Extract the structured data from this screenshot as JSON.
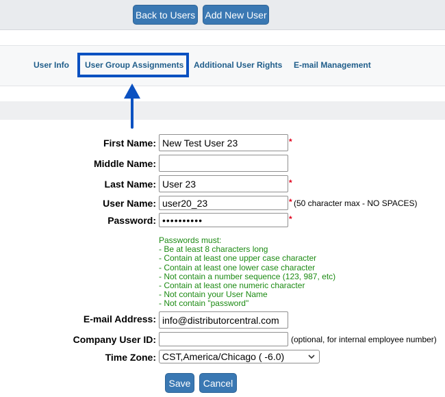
{
  "toolbar": {
    "back_label": "Back to Users",
    "add_label": "Add New User"
  },
  "tabs": [
    {
      "label": "User Info"
    },
    {
      "label": "User Group Assignments"
    },
    {
      "label": "Additional User Rights"
    },
    {
      "label": "E-mail Management"
    }
  ],
  "form": {
    "first_name": {
      "label": "First Name:",
      "value": "New Test User 23"
    },
    "middle_name": {
      "label": "Middle Name:",
      "value": ""
    },
    "last_name": {
      "label": "Last Name:",
      "value": "User 23"
    },
    "user_name": {
      "label": "User Name:",
      "value": "user20_23",
      "hint": "(50 character max - NO SPACES)"
    },
    "password": {
      "label": "Password:",
      "value": "••••••••••"
    },
    "required_mark": "*",
    "password_rules": [
      "Passwords must:",
      "- Be at least 8 characters long",
      "- Contain at least one upper case character",
      "- Contain at least one lower case character",
      "- Not contain a number sequence (123, 987, etc)",
      "- Contain at least one numeric character",
      "- Not contain your User Name",
      "- Not contain \"password\""
    ],
    "email": {
      "label": "E-mail Address:",
      "value": "info@distributorcentral.com"
    },
    "company_user_id": {
      "label": "Company User ID:",
      "value": "",
      "hint": "(optional, for internal employee number)"
    },
    "time_zone": {
      "label": "Time Zone:",
      "value": "CST,America/Chicago ( -6.0)"
    }
  },
  "actions": {
    "save_label": "Save",
    "cancel_label": "Cancel"
  },
  "colors": {
    "button": "#3a78b3",
    "tab_text": "#1f5d8a",
    "highlight": "#0b51c1",
    "required": "#e0001a",
    "rules_text": "#1b8a12"
  }
}
